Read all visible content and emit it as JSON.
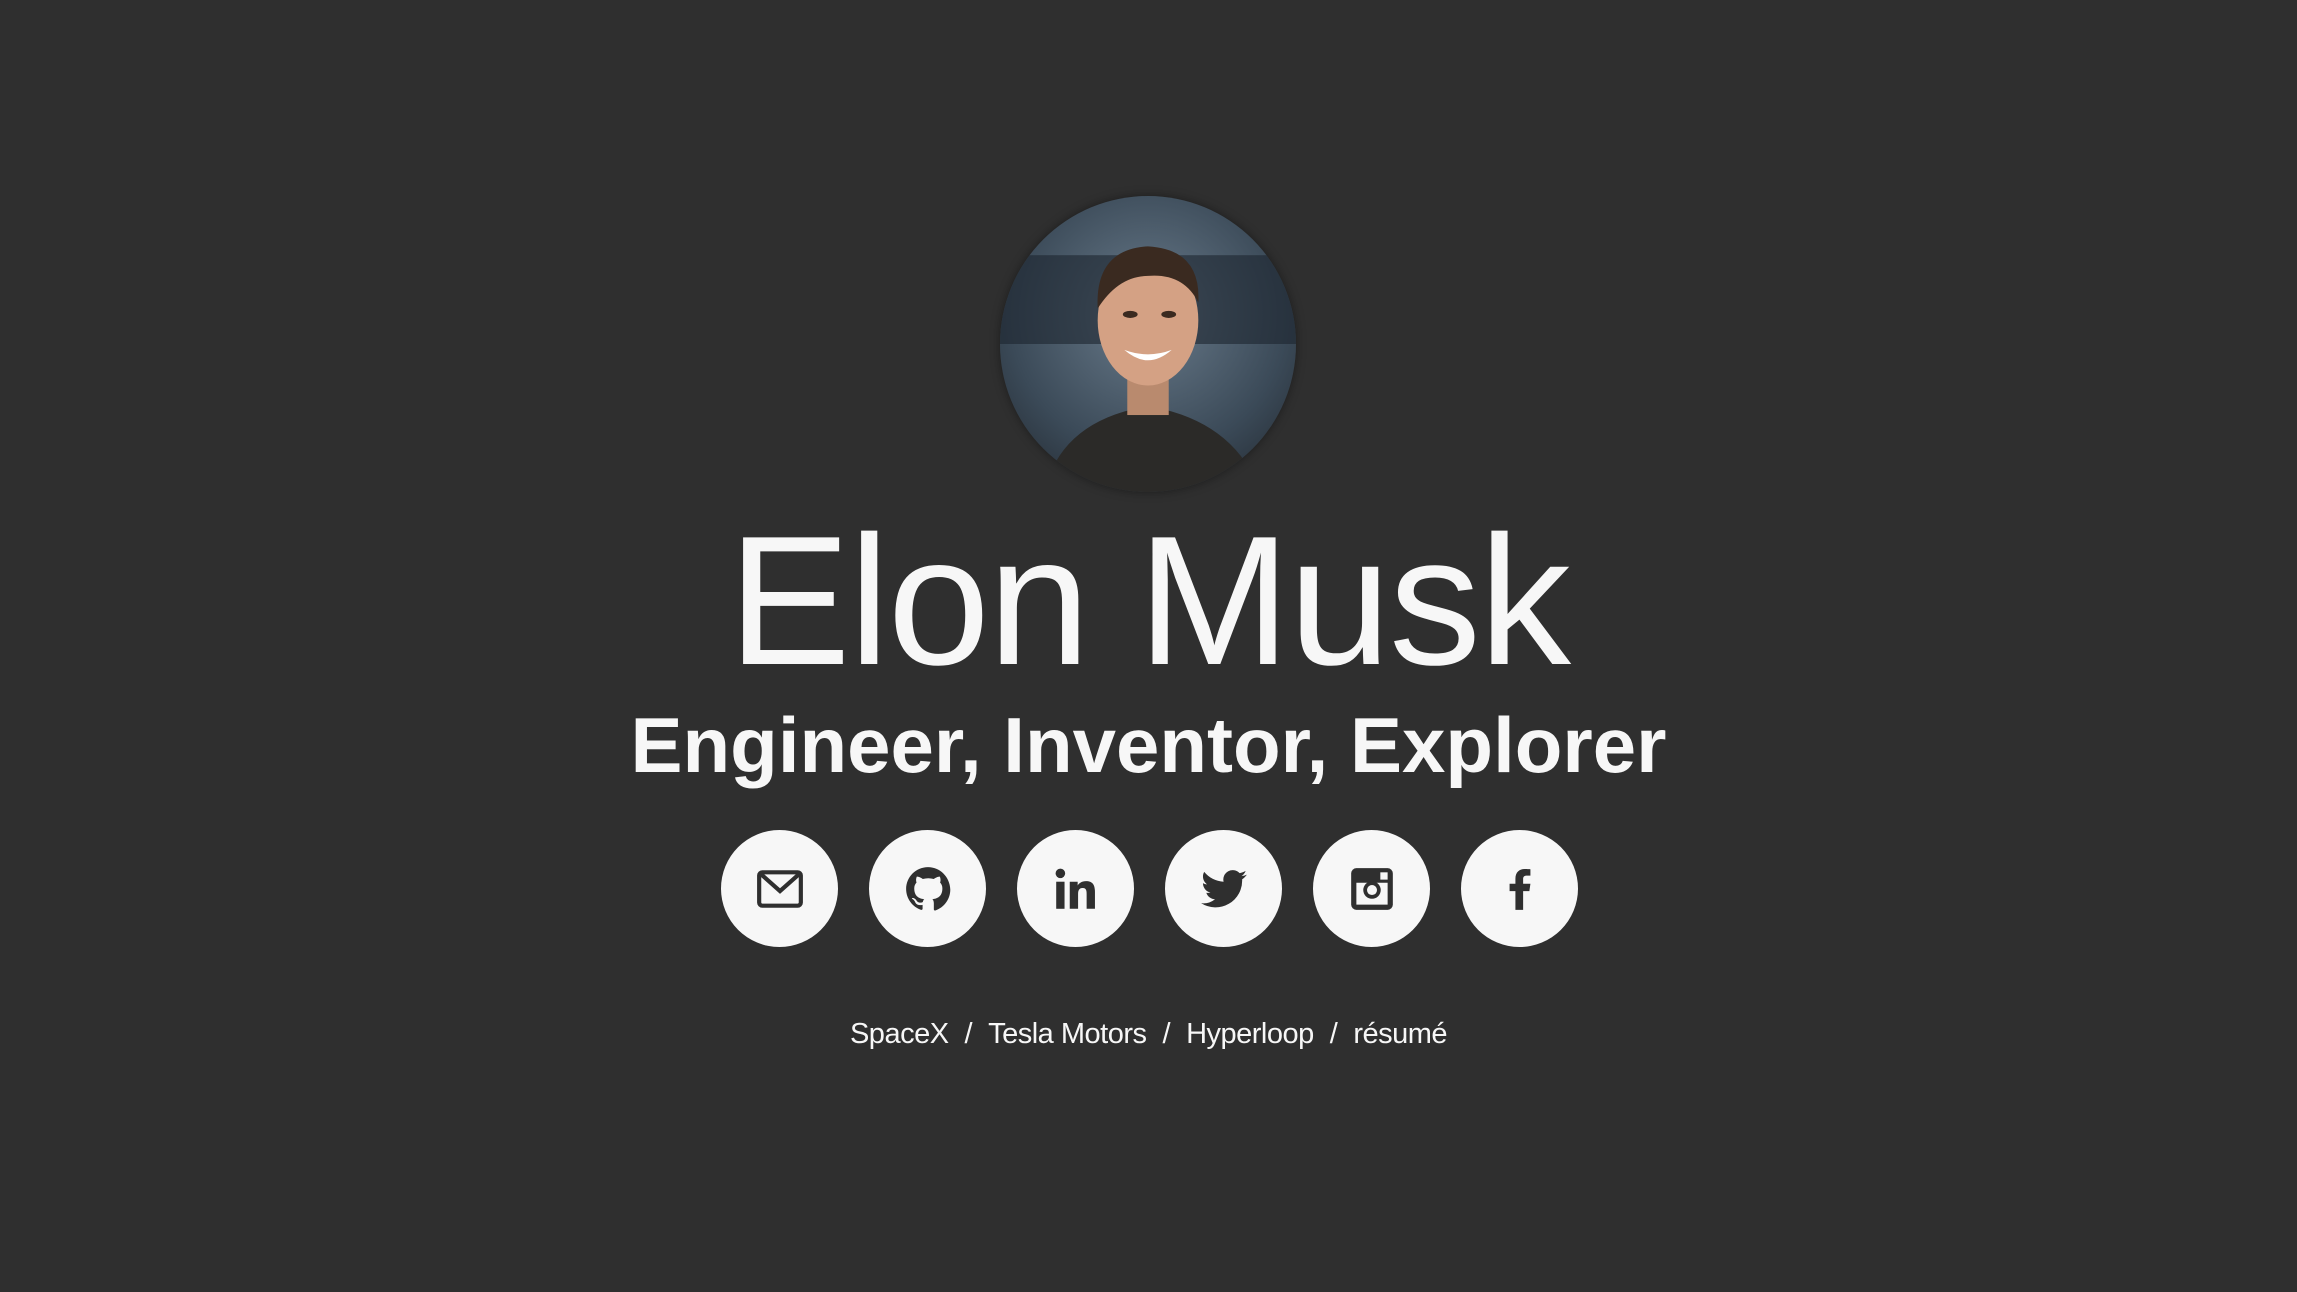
{
  "profile": {
    "name": "Elon Musk",
    "subtitle": "Engineer, Inventor, Explorer"
  },
  "socials": [
    {
      "icon": "envelope-icon",
      "label": "email"
    },
    {
      "icon": "github-icon",
      "label": "github"
    },
    {
      "icon": "linkedin-icon",
      "label": "linkedin"
    },
    {
      "icon": "twitter-icon",
      "label": "twitter"
    },
    {
      "icon": "instagram-icon",
      "label": "instagram"
    },
    {
      "icon": "facebook-icon",
      "label": "facebook"
    }
  ],
  "links": [
    {
      "label": "SpaceX"
    },
    {
      "label": "Tesla Motors"
    },
    {
      "label": "Hyperloop"
    },
    {
      "label": "résumé"
    }
  ],
  "separator": "/",
  "colors": {
    "background": "#2f2f2f",
    "text": "#f7f7f7",
    "button": "#f7f7f7",
    "icon": "#2f2f2f"
  }
}
